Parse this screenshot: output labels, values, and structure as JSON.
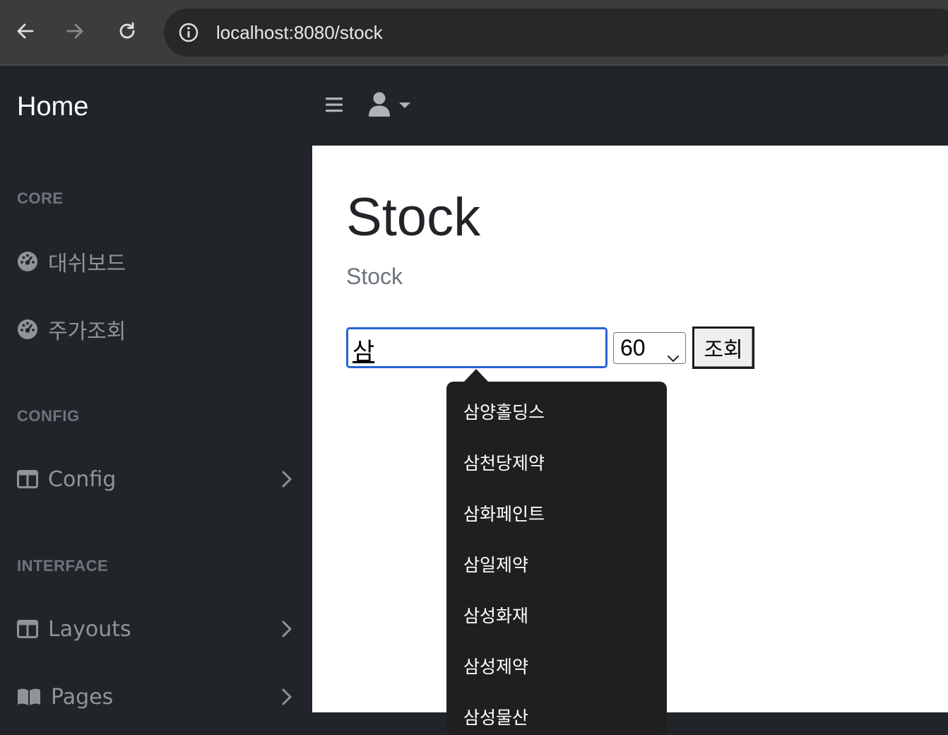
{
  "browser": {
    "url": "localhost:8080/stock",
    "icons": [
      "back-arrow-icon",
      "forward-arrow-icon",
      "reload-icon",
      "info-icon"
    ]
  },
  "navbar": {
    "brand": "Home",
    "icons": [
      "hamburger-icon",
      "user-icon",
      "caret-down-icon"
    ]
  },
  "sidebar": {
    "sections": [
      {
        "heading": "CORE"
      },
      {
        "heading": "CONFIG"
      },
      {
        "heading": "INTERFACE"
      }
    ],
    "items": [
      {
        "label": "대쉬보드",
        "icon": "tachometer-icon"
      },
      {
        "label": "주가조회",
        "icon": "tachometer-icon"
      },
      {
        "label": "Config",
        "icon": "columns-icon",
        "has_children": true
      },
      {
        "label": "Layouts",
        "icon": "columns-icon",
        "has_children": true
      },
      {
        "label": "Pages",
        "icon": "book-open-icon",
        "has_children": true
      }
    ]
  },
  "main": {
    "title": "Stock",
    "breadcrumb": "Stock",
    "search": {
      "value": "삼"
    },
    "period": {
      "selected": "60"
    },
    "submit_label": "조회",
    "suggestions": [
      "삼양홀딩스",
      "삼천당제약",
      "삼화페인트",
      "삼일제약",
      "삼성화재",
      "삼성제약",
      "삼성물산"
    ]
  },
  "colors": {
    "sidebar_bg": "#212529",
    "main_bg": "#ffffff",
    "accent": "#2862d4",
    "muted": "#6c757d",
    "dropdown_bg": "#1f1f1f"
  }
}
